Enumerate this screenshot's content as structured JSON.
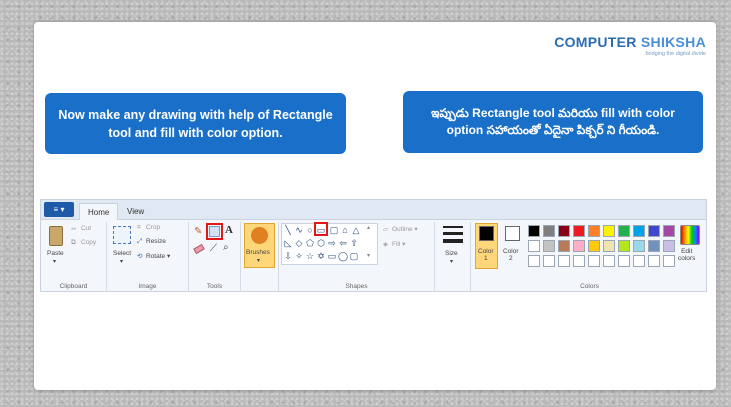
{
  "logo": {
    "text_first": "COMPUTER",
    "text_second": " SHIKSHA",
    "tagline": "bridging the digital divide"
  },
  "callouts": {
    "english": "Now make any drawing with help of Rectangle  tool and fill with color option.",
    "telugu": "ఇప్పుడు Rectangle  tool మరియు fill with color option సహాయంతో ఏదైనా పిక్చర్ ని గీయండి."
  },
  "ribbon": {
    "file_button": "≡ ▾",
    "tabs": [
      "Home",
      "View"
    ],
    "clipboard": {
      "paste": "Paste",
      "cut": "Cut",
      "copy": "Copy",
      "label": "Clipboard"
    },
    "image": {
      "select": "Select",
      "crop": "Crop",
      "resize": "Resize",
      "rotate": "Rotate ▾",
      "label": "Image"
    },
    "tools": {
      "label": "Tools",
      "text_tool": "A"
    },
    "brushes": {
      "label": "Brushes"
    },
    "shapes": {
      "outline": "Outline ▾",
      "fill": "Fill ▾",
      "label": "Shapes",
      "glyphs": [
        "╲",
        "∿",
        "○",
        "▭",
        "▢",
        "⌂",
        "△",
        "◺",
        "◇",
        "⬠",
        "⬡",
        "⇨",
        "⇦",
        "⇧",
        "⇩",
        "✧",
        "☆",
        "✡",
        "▭",
        "◯",
        "▢"
      ]
    },
    "size": {
      "label": "Size"
    },
    "colors": {
      "color1": "Color\n1",
      "color2": "Color\n2",
      "edit": "Edit\ncolors",
      "label": "Colors",
      "row1": [
        "#000000",
        "#7f7f7f",
        "#880015",
        "#ed1c24",
        "#ff7f27",
        "#fff200",
        "#22b14c",
        "#00a2e8",
        "#3f48cc",
        "#a349a4"
      ],
      "row2": [
        "#ffffff",
        "#c3c3c3",
        "#b97a57",
        "#ffaec9",
        "#ffc90e",
        "#efe4b0",
        "#b5e61d",
        "#99d9ea",
        "#7092be",
        "#c8bfe7"
      ],
      "color1_value": "#000000",
      "color2_value": "#ffffff"
    }
  }
}
